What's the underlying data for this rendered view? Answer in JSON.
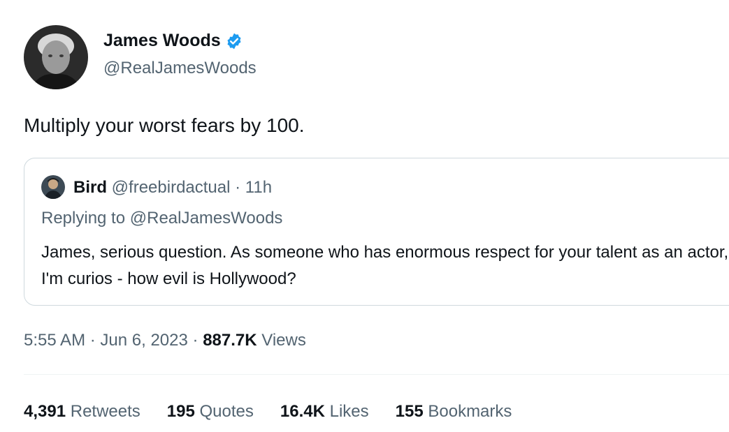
{
  "author": {
    "name": "James Woods",
    "handle": "@RealJamesWoods"
  },
  "tweet": {
    "text": "Multiply your worst fears by 100."
  },
  "quoted": {
    "name": "Bird",
    "handle": "@freebirdactual",
    "separator": "·",
    "time": "11h",
    "reply_prefix": "Replying to",
    "reply_handle": "@RealJamesWoods",
    "text": "James, serious question. As someone who has enormous respect for your talent as an actor, I'm curios - how evil is Hollywood?"
  },
  "meta": {
    "time": "5:55 AM",
    "separator": "·",
    "date": "Jun 6, 2023",
    "views_count": "887.7K",
    "views_label": "Views"
  },
  "stats": [
    {
      "count": "4,391",
      "label": "Retweets"
    },
    {
      "count": "195",
      "label": "Quotes"
    },
    {
      "count": "16.4K",
      "label": "Likes"
    },
    {
      "count": "155",
      "label": "Bookmarks"
    }
  ],
  "colors": {
    "verified": "#1d9bf0",
    "secondary_text": "#536471",
    "primary_text": "#0f1419",
    "border": "#cfd9de"
  },
  "icons": {
    "verified": "verified-badge-icon"
  }
}
